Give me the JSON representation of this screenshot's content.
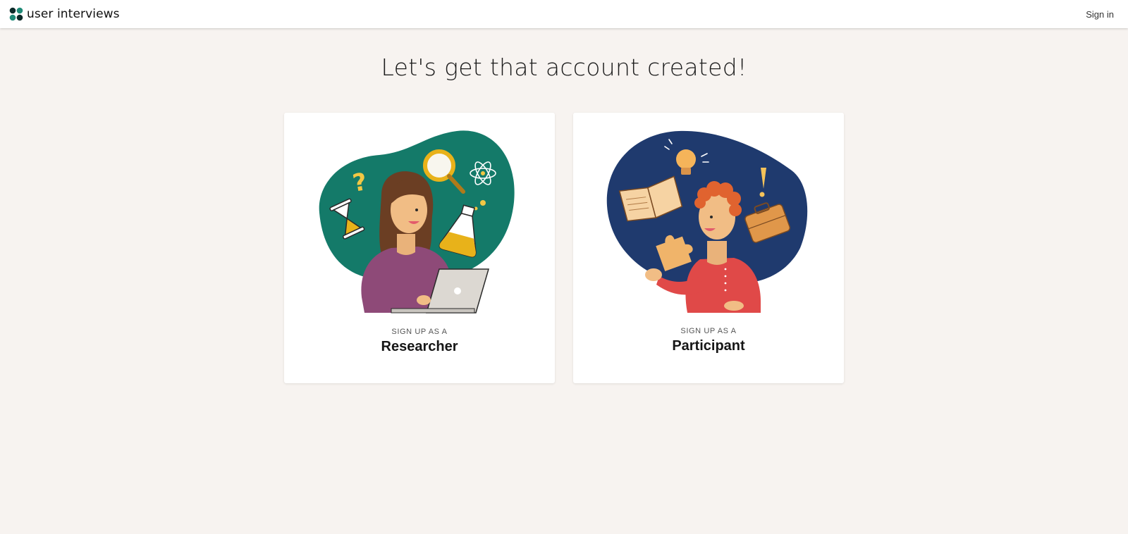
{
  "header": {
    "brand_name": "user interviews",
    "signin_label": "Sign in"
  },
  "main": {
    "headline": "Let's get that account created!",
    "cards": [
      {
        "eyebrow": "SIGN UP AS A",
        "role": "Researcher",
        "illustration": "researcher-at-laptop"
      },
      {
        "eyebrow": "SIGN UP AS A",
        "role": "Participant",
        "illustration": "participant-with-ideas"
      }
    ]
  },
  "colors": {
    "page_bg": "#f7f3f0",
    "topbar_bg": "#ffffff",
    "researcher_blob": "#147a69",
    "participant_blob": "#1f3a6e",
    "brand_dark": "#0d2b2a",
    "brand_teal": "#1e8a77"
  }
}
